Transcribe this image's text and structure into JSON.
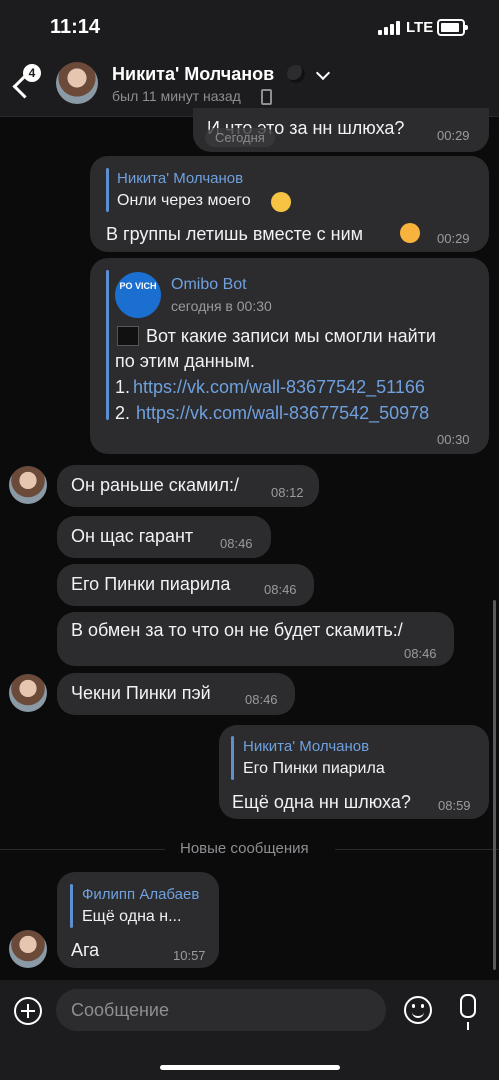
{
  "status_bar": {
    "time": "11:14",
    "network": "LTE"
  },
  "header": {
    "back_badge": "4",
    "contact_name": "Никита' Молчанов",
    "status": "был 11 минут назад"
  },
  "date_chip": "Сегодня",
  "messages": [
    {
      "text": "И что это за нн шлюха?",
      "time": "00:29"
    },
    {
      "reply_name": "Никита' Молчанов",
      "reply_text": "Онли через моего",
      "text": "В группы летишь вместе с ним",
      "time": "00:29"
    },
    {
      "bot_name": "Omibo Bot",
      "bot_time": "сегодня в 00:30",
      "avatar_text": "PO VICH",
      "line1": "Вот какие записи мы смогли найти",
      "line2": "по этим данным.",
      "link1_num": "1.",
      "link1": "https://vk.com/wall-83677542_51166",
      "link2_num": "2.",
      "link2": "https://vk.com/wall-83677542_50978",
      "time": "00:30"
    },
    {
      "text": "Он раньше скамил:/",
      "time": "08:12"
    },
    {
      "text": "Он щас гарант",
      "time": "08:46"
    },
    {
      "text": "Его Пинки пиарила",
      "time": "08:46"
    },
    {
      "text": "В обмен за то что он не будет скамить:/",
      "time": "08:46"
    },
    {
      "text": "Чекни Пинки пэй",
      "time": "08:46"
    },
    {
      "reply_name": "Никита' Молчанов",
      "reply_text": "Его Пинки пиарила",
      "text": "Ещё одна нн шлюха?",
      "time": "08:59"
    },
    {
      "reply_name": "Филипп Алабаев",
      "reply_text": "Ещё одна н...",
      "text": "Ага",
      "time": "10:57"
    }
  ],
  "new_messages_divider": "Новые сообщения",
  "composer": {
    "placeholder": "Сообщение"
  }
}
